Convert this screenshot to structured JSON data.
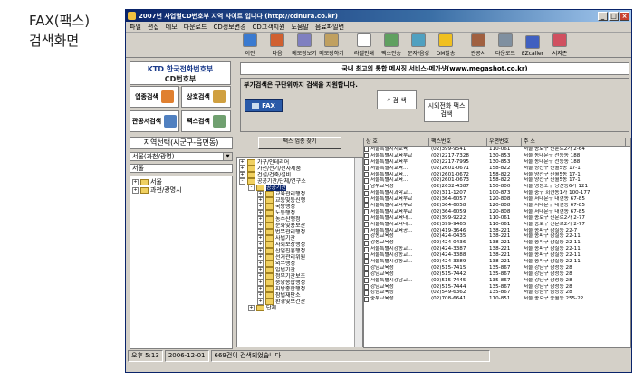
{
  "caption": {
    "line1": "FAX(팩스)",
    "line2": "검색화면"
  },
  "window": {
    "title": "2007년 사업별CD번호부 지역 사이트 입니다 (http://cdnura.co.kr)"
  },
  "menu": [
    "파일",
    "편집",
    "메모",
    "다운로드",
    "CD정보변경",
    "CD고객지원",
    "도움말",
    "음료파일변"
  ],
  "toolbar": [
    {
      "label": "이전",
      "icon": "left-arrow-icon",
      "color": "#3a7ad0"
    },
    {
      "label": "다음",
      "icon": "right-arrow-icon",
      "color": "#d06030"
    },
    {
      "label": "메모장보기",
      "icon": "memo-icon",
      "color": "#8080c0"
    },
    {
      "label": "메모장하기",
      "icon": "memo-write-icon",
      "color": "#c0a060"
    },
    {
      "label": "라벨인쇄",
      "icon": "label-icon",
      "color": "#fff"
    },
    {
      "label": "팩스전송",
      "icon": "fax-icon",
      "color": "#60a060"
    },
    {
      "label": "문자/음성",
      "icon": "sms-icon",
      "color": "#50a0c0"
    },
    {
      "label": "DM발송",
      "icon": "mail-icon",
      "color": "#f0c020"
    },
    {
      "label": "관공서",
      "icon": "gov-icon",
      "color": "#a06040"
    },
    {
      "label": "다운로드",
      "icon": "download-icon",
      "color": "#8090a0"
    },
    {
      "label": "EZcaller",
      "icon": "ezcaller-icon",
      "color": "#4060c0"
    },
    {
      "label": "서지존",
      "icon": "book-icon",
      "color": "#d05060"
    }
  ],
  "logo": {
    "line1": "KTD 한국전화번호부",
    "line2": "CD번호부"
  },
  "search_buttons": [
    {
      "label": "업종검색",
      "icon": "business-search-icon",
      "color": "#e08030"
    },
    {
      "label": "상호검색",
      "icon": "company-search-icon",
      "color": "#d0a040"
    },
    {
      "label": "관공서검색",
      "icon": "gov-search-icon",
      "color": "#5080c0"
    },
    {
      "label": "팩스검색",
      "icon": "fax-search-icon",
      "color": "#70a070"
    }
  ],
  "banner": "국내 최고의 통합 메시징 서비스-메가샷(www.megashot.co.kr)",
  "filter": {
    "notice": "부가검색은 구단위까지 검색을 지원합니다.",
    "fax_button": "FAX",
    "search_button": "검 색",
    "fax_search_button": "시외전화 팩스 검색"
  },
  "region": {
    "title": "지역선택(시군구-읍면동)",
    "select_value": "서울(과천/광명)",
    "input_value": "서울",
    "tree": [
      {
        "label": "서울",
        "expand": "+"
      },
      {
        "label": "과천/광명시",
        "expand": "+"
      }
    ]
  },
  "category": {
    "title": "팩스 업종 찾기",
    "tree": [
      {
        "label": "가구/인테리어",
        "level": 1,
        "expand": "+"
      },
      {
        "label": "가전/전기/전자제품",
        "level": 1,
        "expand": "+"
      },
      {
        "label": "건설/건축/설비",
        "level": 1,
        "expand": "+"
      },
      {
        "label": "공공기관/단체/연구소",
        "level": 1,
        "expand": "-"
      },
      {
        "label": "공공기관",
        "level": 2,
        "expand": "-",
        "selected": true
      },
      {
        "label": "교육관리행정",
        "level": 3,
        "expand": "+"
      },
      {
        "label": "교통및통신행",
        "level": 3,
        "expand": "+"
      },
      {
        "label": "국방행정",
        "level": 3,
        "expand": "+"
      },
      {
        "label": "노동행정",
        "level": 3,
        "expand": "+"
      },
      {
        "label": "농수산행정",
        "level": 3,
        "expand": "+"
      },
      {
        "label": "문화및홍보관",
        "level": 3,
        "expand": "+"
      },
      {
        "label": "법무관리행정",
        "level": 3,
        "expand": "+"
      },
      {
        "label": "사법기관",
        "level": 3,
        "expand": "+"
      },
      {
        "label": "사회보장행정",
        "level": 3,
        "expand": "+"
      },
      {
        "label": "산업진흥행정",
        "level": 3,
        "expand": "+"
      },
      {
        "label": "선거관리위원",
        "level": 3,
        "expand": "+"
      },
      {
        "label": "외무행정",
        "level": 3,
        "expand": "+"
      },
      {
        "label": "입법기관",
        "level": 3,
        "expand": "+"
      },
      {
        "label": "정부기관보조",
        "level": 3,
        "expand": "+"
      },
      {
        "label": "중앙종합행정",
        "level": 3,
        "expand": "+"
      },
      {
        "label": "지방종합행정",
        "level": 3,
        "expand": "+"
      },
      {
        "label": "참법재판소",
        "level": 3,
        "expand": "+"
      },
      {
        "label": "환경및보건관",
        "level": 3,
        "expand": "+"
      },
      {
        "label": "단체",
        "level": 2,
        "expand": "+"
      }
    ]
  },
  "results": {
    "columns": [
      "상 호",
      "팩스번호",
      "우편번호",
      "주 소"
    ],
    "rows": [
      [
        "서울특별시시교육",
        "(02)399-9541",
        "110-061",
        "서울 종로구 신문로2가 2-64"
      ],
      [
        "서울특별시교육부교",
        "(02)2217-7328",
        "130-853",
        "서울 동대문구 전동동 188"
      ],
      [
        "서울특별시교육부",
        "(02)2217-7995",
        "130-853",
        "서울 동대문구 전동동 188"
      ],
      [
        "서울특별시교육...",
        "(02)2601-0671",
        "158-822",
        "서울 양천구 신월5동 17-1"
      ],
      [
        "서울특별시교육...",
        "(02)2601-0672",
        "158-822",
        "서울 양천구 신월5동 17-1"
      ],
      [
        "서울특별시교육...",
        "(02)2601-0673",
        "158-822",
        "서울 양천구 신월5동 17-1"
      ],
      [
        "남부교육청",
        "(02)2632-4387",
        "150-800",
        "서울 영등포구 당산동6가 121"
      ],
      [
        "서울특별시과학교...",
        "(02)311-1207",
        "100-873",
        "서울 중구 회현동1가 100-177"
      ],
      [
        "서울특별시교육부교",
        "(02)364-6057",
        "120-808",
        "서울 서대문구 대현동 67-85"
      ],
      [
        "서울특별시교육부교",
        "(02)364-6058",
        "120-808",
        "서울 서대문구 대현동 67-85"
      ],
      [
        "서울특별시교육부교",
        "(02)364-6059",
        "120-808",
        "서울 서대문구 대현동 67-85"
      ],
      [
        "서울특별시교육대...",
        "(02)399-9222",
        "110-061",
        "서울 종로구 신문로2가 2-77"
      ],
      [
        "서울특별시교육대...",
        "(02)399-9465",
        "110-061",
        "서울 종로구 신문로2가 2-77"
      ],
      [
        "서울특별시교육공...",
        "(02)419-3646",
        "138-221",
        "서울 송파구 잠실동 22-7"
      ],
      [
        "강동교육청",
        "(02)424-0435",
        "138-221",
        "서울 송파구 잠실동 22-11"
      ],
      [
        "강동교육청",
        "(02)424-0436",
        "138-221",
        "서울 송파구 잠실동 22-11"
      ],
      [
        "서울특별시강동교...",
        "(02)424-3387",
        "138-221",
        "서울 송파구 잠실동 22-11"
      ],
      [
        "서울특별시강동교...",
        "(02)424-3388",
        "138-221",
        "서울 송파구 잠실동 22-11"
      ],
      [
        "서울특별시강동교...",
        "(02)424-3389",
        "138-221",
        "서울 송파구 잠실동 22-11"
      ],
      [
        "강남교육청",
        "(02)515-7415",
        "135-867",
        "서울 강남구 삼성동 28"
      ],
      [
        "강남교육청",
        "(02)515-7442",
        "135-867",
        "서울 강남구 삼성동 28"
      ],
      [
        "서울특별시강남교...",
        "(02)515-7445",
        "135-867",
        "서울 강남구 삼성동 28"
      ],
      [
        "강남교육청",
        "(02)515-7444",
        "135-867",
        "서울 강남구 삼성동 28"
      ],
      [
        "강남교육청",
        "(02)549-6362",
        "135-867",
        "서울 강남구 삼성동 28"
      ],
      [
        "중부교육청",
        "(02)708-6641",
        "110-851",
        "서울 종로구 송월동 255-22"
      ]
    ]
  },
  "status": {
    "time": "오후 5:13",
    "date": "2006-12-01",
    "message": "669건이 검색되었습니다"
  }
}
